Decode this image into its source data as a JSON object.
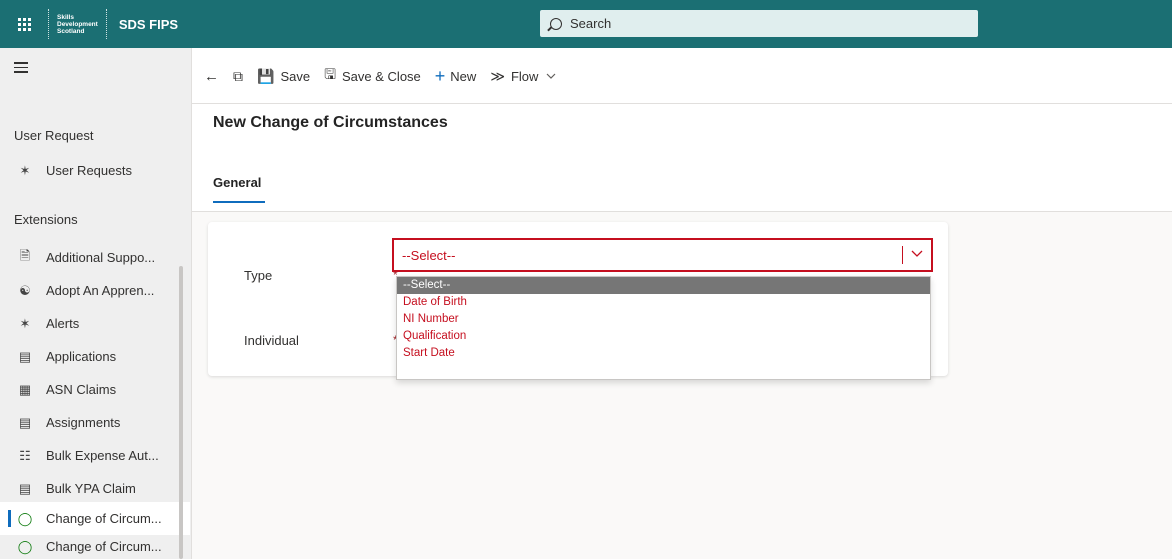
{
  "topbar": {
    "logo_lines": [
      "Skills",
      "Development",
      "Scotland"
    ],
    "app_name": "SDS FIPS",
    "search_placeholder": "Search"
  },
  "sidebar": {
    "group1_heading": "User Request",
    "group1_items": [
      {
        "label": "User Requests",
        "icon": "puzzle-icon"
      }
    ],
    "group2_heading": "Extensions",
    "group2_items": [
      {
        "label": "Additional Suppo...",
        "icon": "document-icon"
      },
      {
        "label": "Adopt An Appren...",
        "icon": "apprentice-icon"
      },
      {
        "label": "Alerts",
        "icon": "puzzle-icon"
      },
      {
        "label": "Applications",
        "icon": "page-icon"
      },
      {
        "label": "ASN Claims",
        "icon": "claims-icon"
      },
      {
        "label": "Assignments",
        "icon": "list-icon"
      },
      {
        "label": "Bulk Expense Aut...",
        "icon": "bulk-icon"
      },
      {
        "label": "Bulk YPA Claim",
        "icon": "list-icon"
      },
      {
        "label": "Change of Circum...",
        "icon": "check-circle-icon",
        "active": true
      },
      {
        "label": "Change of Circum...",
        "icon": "check-circle-icon"
      }
    ]
  },
  "commandbar": {
    "save": "Save",
    "save_close": "Save & Close",
    "new": "New",
    "flow": "Flow"
  },
  "form": {
    "title": "New Change of Circumstances",
    "tab": "General",
    "fields": [
      {
        "label": "Type",
        "required_mark": "*"
      },
      {
        "label": "Individual",
        "required_mark": "*"
      }
    ],
    "type_value": "--Select--",
    "type_options": [
      "--Select--",
      "Date of Birth",
      "NI Number",
      "Qualification",
      "Start Date"
    ]
  },
  "colors": {
    "topbar": "#1b6f73",
    "accent": "#0f6cbd",
    "error": "#c50f1f"
  }
}
